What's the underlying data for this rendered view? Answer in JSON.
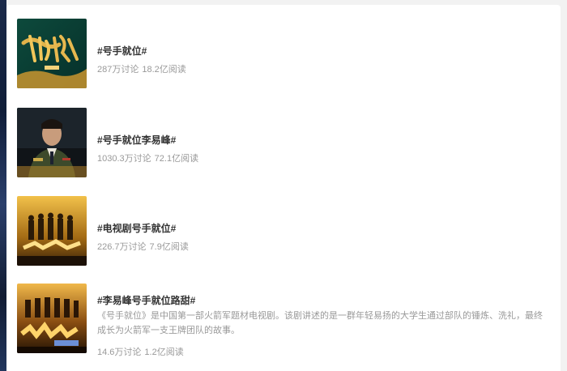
{
  "topics": [
    {
      "title": "#号手就位#",
      "discussions": "287万讨论",
      "reads": "18.2亿阅读",
      "thumb_icon": "poster-calligraphy-icon"
    },
    {
      "title": "#号手就位李易峰#",
      "discussions": "1030.3万讨论",
      "reads": "72.1亿阅读",
      "thumb_icon": "poster-soldier-portrait-icon"
    },
    {
      "title": "#电视剧号手就位#",
      "discussions": "226.7万讨论",
      "reads": "7.9亿阅读",
      "thumb_icon": "poster-troop-lineup-icon"
    },
    {
      "title": "#李易峰号手就位路甜#",
      "description": "《号手就位》是中国第一部火箭军题材电视剧。该剧讲述的是一群年轻易扬的大学生通过部队的锤炼、洗礼，最终成长为火箭军一支王牌团队的故事。",
      "discussions": "14.6万讨论",
      "reads": "1.2亿阅读",
      "thumb_icon": "poster-troop-title-icon"
    }
  ],
  "colors": {
    "title_text": "#333333",
    "meta_text": "#999999",
    "panel_bg": "#ffffff",
    "page_bg": "#f2f2f2"
  }
}
